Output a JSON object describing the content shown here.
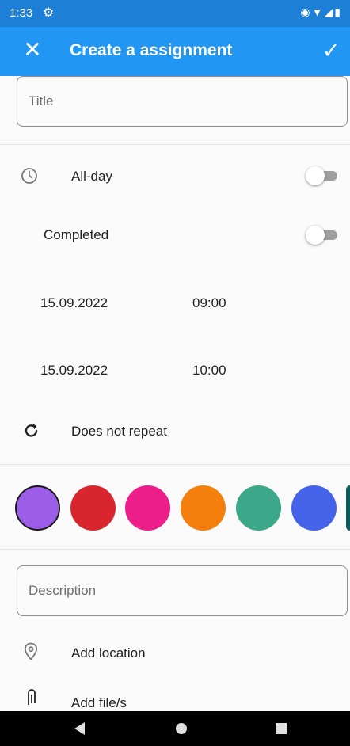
{
  "status_bar": {
    "time": "1:33",
    "settings_icon": "gear-icon",
    "system_icons": [
      "vibrate-icon",
      "wifi-icon",
      "signal-icon",
      "battery-icon"
    ]
  },
  "app_bar": {
    "title": "Create a assignment",
    "close_icon": "close-icon",
    "save_icon": "check-icon",
    "color": "#2196f3"
  },
  "form": {
    "title_placeholder": "Title",
    "all_day_label": "All-day",
    "completed_label": "Completed",
    "start_date": "15.09.2022",
    "start_time": "09:00",
    "end_date": "15.09.2022",
    "end_time": "10:00",
    "repeat_label": "Does not repeat",
    "description_placeholder": "Description",
    "location_label": "Add location",
    "files_label": "Add file/s"
  },
  "colors": [
    "#9c5ee8",
    "#d9262e",
    "#ec1f8a",
    "#f47f0c",
    "#3ca889",
    "#4563e8",
    "#0d5a5a"
  ],
  "selected_color": "#9c5ee8",
  "nav_bar": {
    "buttons": [
      "back-icon",
      "home-icon",
      "recents-icon"
    ]
  }
}
